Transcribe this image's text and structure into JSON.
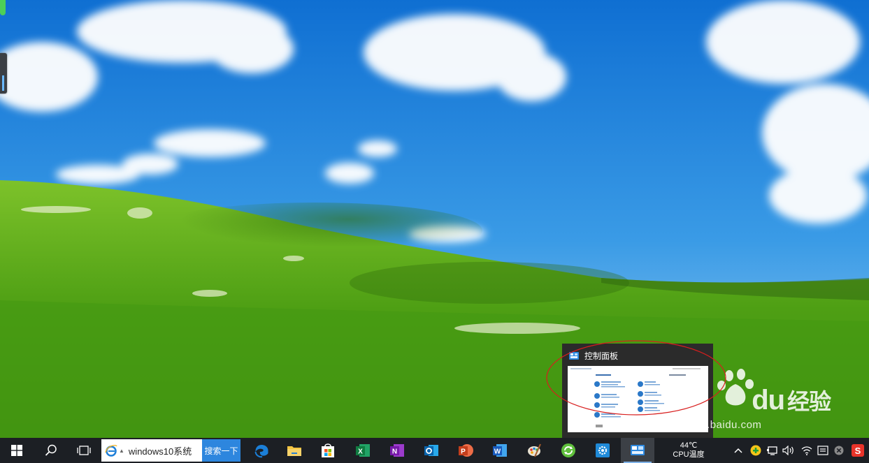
{
  "preview": {
    "title": "控制面板",
    "window_title_mini": "控制面板"
  },
  "watermark": {
    "brand_text": "Bai",
    "brand_du": "du",
    "brand_cn": "经验",
    "url": "jingyan.baidu.com"
  },
  "taskbar": {
    "search_text": "windows10系统",
    "search_button": "搜索一下",
    "temperature": "44℃",
    "temperature_label": "CPU温度",
    "icons": [
      "windows-start-icon",
      "search-icon",
      "task-view-icon",
      "ie-icon",
      "edge-icon",
      "file-explorer-icon",
      "store-icon",
      "excel-icon",
      "onenote-icon",
      "outlook-icon",
      "powerpoint-icon",
      "word-icon",
      "paint-icon",
      "refresh-app-icon",
      "settings-icon",
      "control-panel-icon"
    ]
  },
  "colors": {
    "taskbar_bg": "#1c1f24",
    "search_button_bg": "#2d86de",
    "annotation_red": "#d81e1e"
  }
}
